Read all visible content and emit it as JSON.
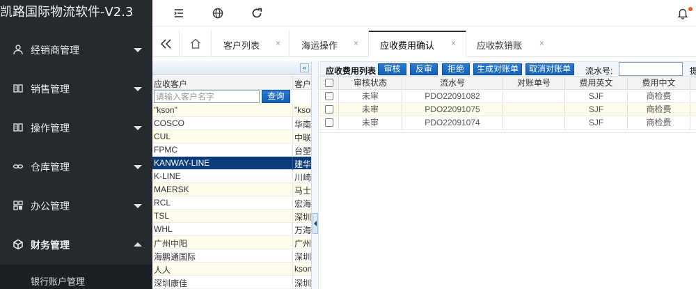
{
  "app": {
    "title": "凯路国际物流软件-V2.3"
  },
  "sidebar": {
    "items": [
      {
        "label": "经销商管理",
        "icon": "user-icon",
        "expanded": false
      },
      {
        "label": "销售管理",
        "icon": "book-icon",
        "expanded": false
      },
      {
        "label": "操作管理",
        "icon": "book-icon",
        "expanded": false
      },
      {
        "label": "仓库管理",
        "icon": "link-icon",
        "expanded": false
      },
      {
        "label": "办公管理",
        "icon": "grid-icon",
        "expanded": false
      },
      {
        "label": "财务管理",
        "icon": "cube-icon",
        "expanded": true
      }
    ],
    "submenu": {
      "label": "银行账户管理"
    }
  },
  "topbar": {
    "icons": [
      "menu-icon",
      "globe-icon",
      "refresh-icon",
      "bell-icon"
    ]
  },
  "tabs": [
    {
      "label": "客户列表",
      "active": false
    },
    {
      "label": "海运操作",
      "active": false
    },
    {
      "label": "应收费用确认",
      "active": true
    },
    {
      "label": "应收款销账",
      "active": false
    }
  ],
  "tab_close_glyph": "×",
  "left_panel": {
    "collapse_glyph": "«",
    "col1": "应收客户",
    "col2": "客户",
    "search_placeholder": "请输入客户名字",
    "query_label": "查询",
    "rows": [
      {
        "code": "\"kson\"",
        "name": "\"kson"
      },
      {
        "code": "COSCO",
        "name": "华南"
      },
      {
        "code": "CUL",
        "name": "中联"
      },
      {
        "code": "FPMC",
        "name": "台塑"
      },
      {
        "code": "KANWAY-LINE",
        "name": "建华",
        "selected": true
      },
      {
        "code": "K-LINE",
        "name": "川崎"
      },
      {
        "code": "MAERSK",
        "name": "马士"
      },
      {
        "code": "RCL",
        "name": "宏海"
      },
      {
        "code": "TSL",
        "name": "深圳"
      },
      {
        "code": "WHL",
        "name": "万海"
      },
      {
        "code": "广州中阳",
        "name": "广州"
      },
      {
        "code": "海鹏通国际",
        "name": "深圳"
      },
      {
        "code": "人人",
        "name": "kson"
      },
      {
        "code": "深圳康佳",
        "name": "深圳"
      }
    ]
  },
  "right_panel": {
    "toolbar": {
      "title": "应收费用列表",
      "buttons": [
        "审核",
        "反审",
        "拒绝",
        "生成对账单",
        "取消对账单"
      ],
      "serial_label": "流水号:",
      "serial_value": "",
      "more": "提"
    },
    "columns": [
      "审核状态",
      "流水号",
      "对账单号",
      "费用英文",
      "费用中文"
    ],
    "rows": [
      {
        "status": "未审",
        "serial": "PDO22091082",
        "statement": "",
        "fee_en": "SJF",
        "fee_cn": "商检费"
      },
      {
        "status": "未审",
        "serial": "PDO22091075",
        "statement": "",
        "fee_en": "SJF",
        "fee_cn": "商检费"
      },
      {
        "status": "未审",
        "serial": "PDO22091074",
        "statement": "",
        "fee_en": "SJF",
        "fee_cn": "商检费"
      }
    ]
  }
}
